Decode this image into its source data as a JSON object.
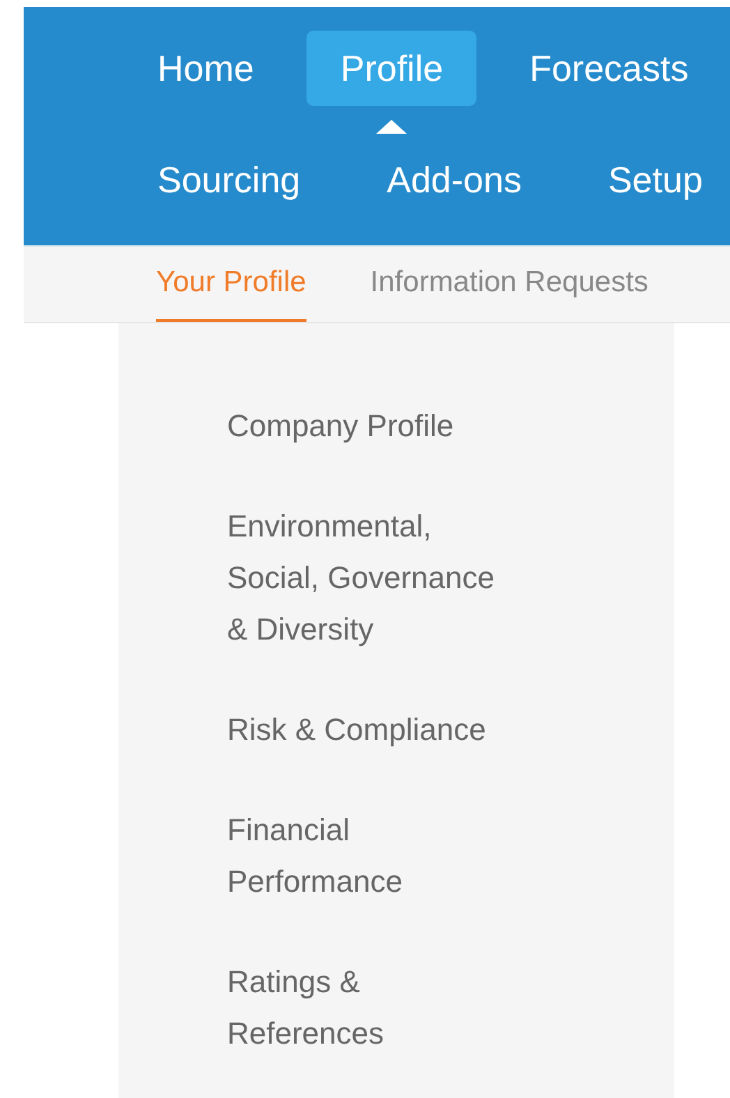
{
  "nav_rows": [
    [
      {
        "label": "Home",
        "selected": false
      },
      {
        "label": "Profile",
        "selected": true
      },
      {
        "label": "Forecasts",
        "selected": false
      }
    ],
    [
      {
        "label": "Sourcing",
        "selected": false
      },
      {
        "label": "Add-ons",
        "selected": false
      },
      {
        "label": "Setup",
        "selected": false
      }
    ]
  ],
  "sub_tabs": [
    {
      "label": "Your Profile",
      "selected": true
    },
    {
      "label": "Information Requests",
      "selected": false
    }
  ],
  "sidebar": {
    "items": [
      {
        "label": "Company Profile"
      },
      {
        "label": "Environmental,\nSocial, Governance\n& Diversity"
      },
      {
        "label": "Risk & Compliance"
      },
      {
        "label": "Financial\nPerformance"
      },
      {
        "label": "Ratings &\nReferences"
      }
    ]
  }
}
